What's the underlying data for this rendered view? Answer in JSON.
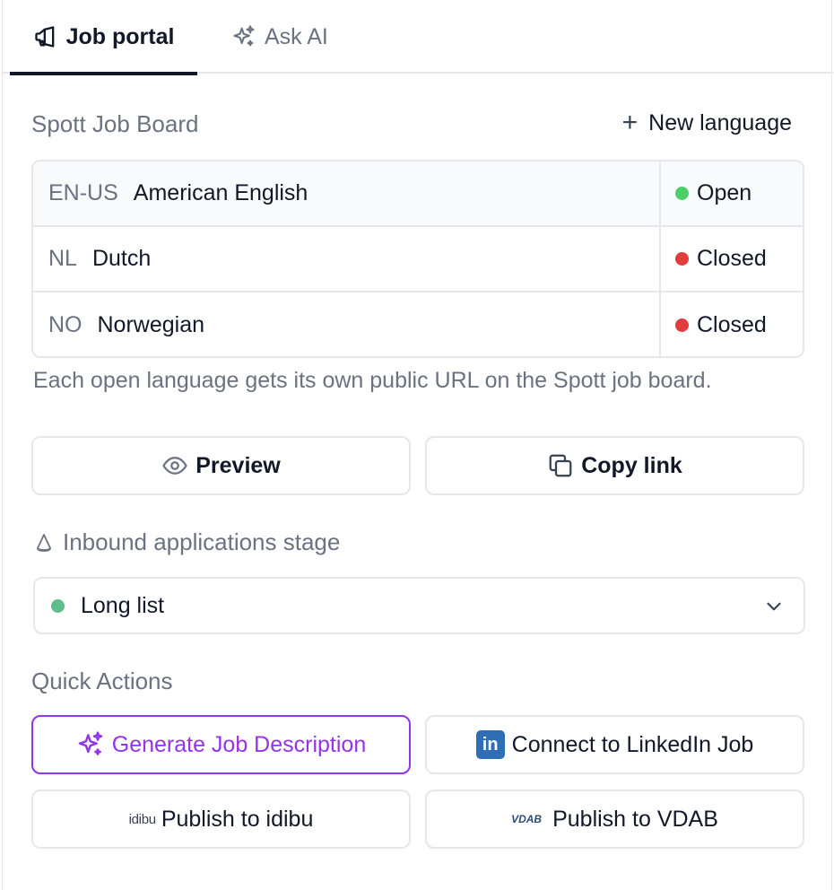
{
  "tabs": [
    {
      "label": "Job portal",
      "icon": "megaphone-icon",
      "active": true
    },
    {
      "label": "Ask AI",
      "icon": "sparkles-icon",
      "active": false
    }
  ],
  "job_board": {
    "title": "Spott Job Board",
    "new_language_label": "New language",
    "languages": [
      {
        "code": "EN-US",
        "name": "American English",
        "status": "Open",
        "status_color": "#4ccf6a"
      },
      {
        "code": "NL",
        "name": "Dutch",
        "status": "Closed",
        "status_color": "#e23c3c"
      },
      {
        "code": "NO",
        "name": "Norwegian",
        "status": "Closed",
        "status_color": "#e23c3c"
      }
    ],
    "helper_text": "Each open language gets its own public URL on the Spott job board."
  },
  "actions": {
    "preview_label": "Preview",
    "copy_link_label": "Copy link"
  },
  "inbound": {
    "label": "Inbound applications stage",
    "selected_value": "Long list",
    "selected_color": "#5cbf8a"
  },
  "quick_actions": {
    "title": "Quick Actions",
    "generate_label": "Generate Job Description",
    "linkedin_label": "Connect to LinkedIn Job",
    "linkedin_badge": "in",
    "idibu_logo": "idibu",
    "idibu_label": "Publish to idibu",
    "vdab_logo": "VDAB",
    "vdab_label": "Publish to VDAB",
    "accent_color": "#9333ea"
  }
}
